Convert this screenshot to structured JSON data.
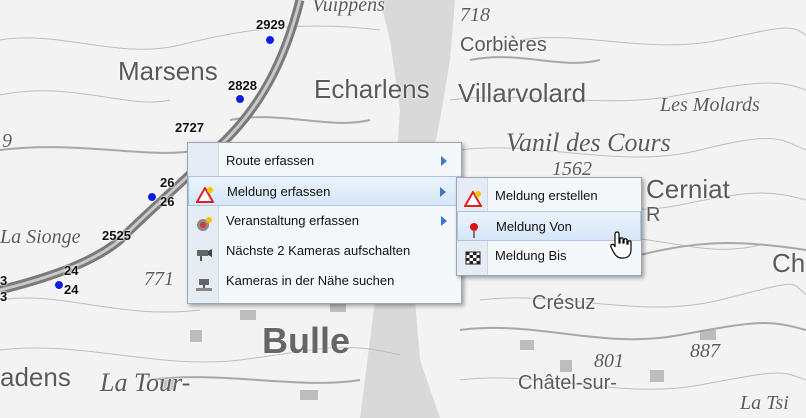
{
  "map": {
    "places": [
      "Marsens",
      "Echarlens",
      "Corbières",
      "Villarvolard",
      "Les Molards",
      "Vanil des Cours",
      "Cerniat",
      "Bulle",
      "La Tour-",
      "Crésuz",
      "Châtel-sur-",
      "La Sionge",
      "adens",
      "Ch",
      "La Tsi",
      "Vuippens",
      "1562",
      "718",
      "887",
      "801",
      "771",
      "R",
      "9"
    ],
    "motorway_km": [
      "2929",
      "2828",
      "2727",
      "26",
      "26",
      "2525",
      "24",
      "24",
      "3",
      "3"
    ]
  },
  "context_menu": {
    "items": [
      {
        "label": "Route erfassen",
        "icon": "route-icon",
        "submenu": true
      },
      {
        "label": "Meldung erfassen",
        "icon": "warning-triangle-icon",
        "submenu": true
      },
      {
        "label": "Veranstaltung erfassen",
        "icon": "event-icon",
        "submenu": true
      },
      {
        "label": "Nächste 2 Kameras aufschalten",
        "icon": "camera-icon",
        "submenu": false
      },
      {
        "label": "Kameras in der Nähe suchen",
        "icon": "camera-search-icon",
        "submenu": false
      }
    ]
  },
  "submenu": {
    "items": [
      {
        "label": "Meldung erstellen",
        "icon": "warning-new-icon"
      },
      {
        "label": "Meldung Von",
        "icon": "red-pin-icon"
      },
      {
        "label": "Meldung Bis",
        "icon": "checkered-flag-icon"
      }
    ]
  },
  "colors": {
    "highlight": "#d6e6f8",
    "submenu_arrow": "#3b78c8",
    "marker": "#0a1ee6",
    "motorway": "#777777"
  }
}
